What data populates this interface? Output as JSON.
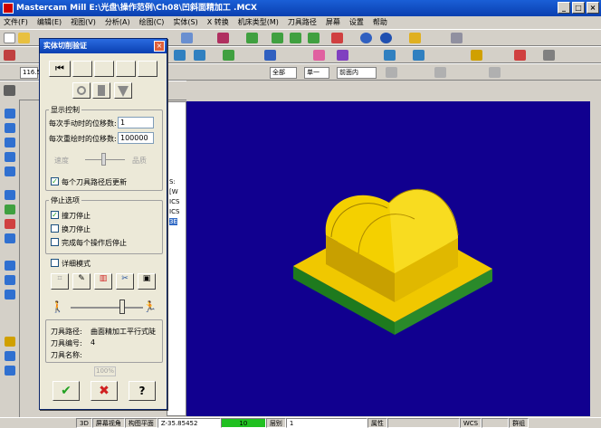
{
  "window": {
    "title": "Mastercam Mill  E:\\光盘\\操作范例\\Ch08\\凹斜面精加工 .MCX",
    "buttons": [
      "_",
      "□",
      "×"
    ]
  },
  "menu": [
    "文件(F)",
    "编辑(E)",
    "视图(V)",
    "分析(A)",
    "绘图(C)",
    "实体(S)",
    "X 转换",
    "机床类型(M)",
    "刀具路径",
    "屏幕",
    "设置",
    "帮助"
  ],
  "toolbar": {
    "combo_all": "全部",
    "combo_single": "单一",
    "combo_base": "前面内",
    "combo_coord": "116.5"
  },
  "dialog": {
    "title": "实体切削验证",
    "close": "×",
    "playback": {
      "rewind": "⏮"
    },
    "display_group": "显示控制",
    "steps_manual_label": "每次手动时的位移数:",
    "steps_manual_value": "1",
    "steps_redraw_label": "每次重绘时的位移数:",
    "steps_redraw_value": "100000",
    "speed_label": "速度",
    "quality_label": "品质",
    "update_each_label": "每个刀具路径后更新",
    "stop_group": "停止选项",
    "stop_collision_label": "撞刀停止",
    "stop_toolchange_label": "换刀停止",
    "stop_each_op_label": "完成每个操作后停止",
    "detail_label": "详细模式",
    "toolpath_label": "刀具路径:",
    "toolpath_value": "曲面精加工平行式陡",
    "tool_number_label": "刀具编号:",
    "tool_number_value": "4",
    "tool_name_label": "刀具名称:",
    "tool_name_value": "",
    "progress_text": "100%",
    "ok_symbol": "✔",
    "cancel_symbol": "✖",
    "help_symbol": "?"
  },
  "statusbar": {
    "mode": "3D",
    "screen_view": "屏幕视角",
    "construction_plane": "构图平面",
    "z_value": "Z-35.85452",
    "color_value": "10",
    "level_label": "层别",
    "level_value": "1",
    "attributes_label": "属性",
    "wcs_label": "WCS",
    "group_label": "群组"
  },
  "colors": {
    "viewport_bg": "#11008f",
    "part_yellow": "#f0c800",
    "part_green": "#1e7a1e",
    "title_blue": "#0a3fb0"
  },
  "tree_partial_text": [
    "S:",
    "[W",
    "ICS",
    "ICS",
    "3E"
  ]
}
